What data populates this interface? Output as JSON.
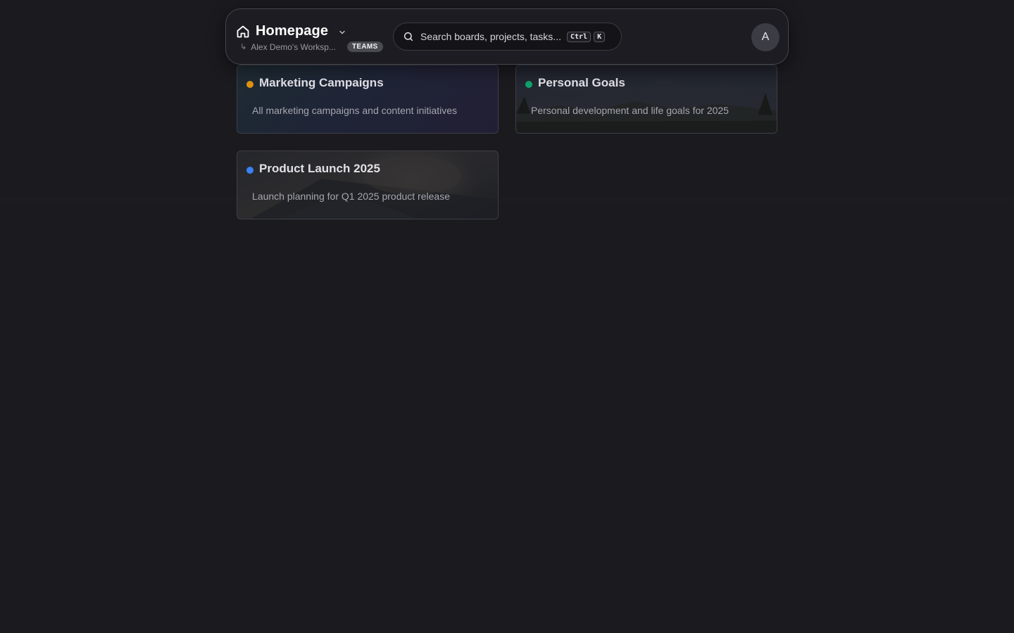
{
  "header": {
    "title": "Homepage",
    "workspace": "Alex Demo's Worksp...",
    "badge": "TEAMS",
    "search": {
      "placeholder": "Search boards, projects, tasks...",
      "shortcut_1": "Ctrl",
      "shortcut_2": "K"
    },
    "avatar_initial": "A"
  },
  "boards": [
    {
      "title": "Marketing Campaigns",
      "description": "All marketing campaigns and content initiatives",
      "dot_color": "#e0930f"
    },
    {
      "title": "Personal Goals",
      "description": "Personal development and life goals for 2025",
      "dot_color": "#10a36a"
    },
    {
      "title": "Product Launch 2025",
      "description": "Launch planning for Q1 2025 product release",
      "dot_color": "#3b82f6"
    }
  ],
  "icons": [
    "home-icon",
    "chevron-down-icon",
    "subdirectory-arrow-icon",
    "search-icon"
  ]
}
